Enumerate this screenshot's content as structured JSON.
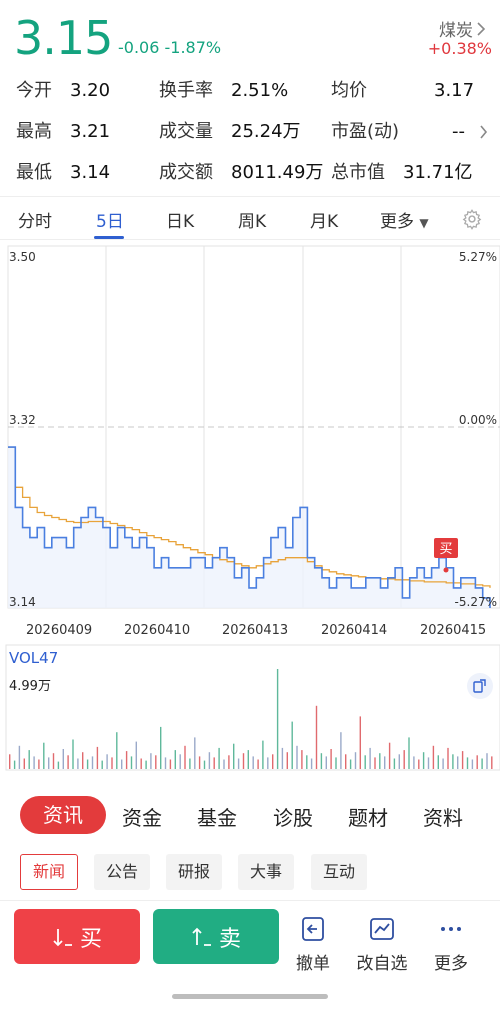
{
  "quote": {
    "price": "3.15",
    "change": "-0.06",
    "change_pct": "-1.87%",
    "sector": "煤炭",
    "sector_change": "+0.38%"
  },
  "stats": {
    "open_label": "今开",
    "open": "3.20",
    "turnover_label": "换手率",
    "turnover": "2.51%",
    "avg_label": "均价",
    "avg": "3.17",
    "high_label": "最高",
    "high": "3.21",
    "volume_label": "成交量",
    "volume": "25.24万",
    "pe_label": "市盈(动)",
    "pe": "--",
    "low_label": "最低",
    "low": "3.14",
    "amount_label": "成交额",
    "amount": "8011.49万",
    "mktcap_label": "总市值",
    "mktcap": "31.71亿"
  },
  "tabs": {
    "intraday": "分时",
    "five_day": "5日",
    "daily": "日K",
    "weekly": "周K",
    "monthly": "月K",
    "more": "更多"
  },
  "chart_data": {
    "type": "line",
    "y_axis_left": [
      "3.50",
      "3.32",
      "3.14"
    ],
    "y_axis_right": [
      "5.27%",
      "0.00%",
      "-5.27%"
    ],
    "ylim": [
      3.14,
      3.5
    ],
    "reference_price": 3.32,
    "dates": [
      "20260409",
      "20260410",
      "20260413",
      "20260414",
      "20260415"
    ],
    "series": [
      {
        "values": [
          3.3,
          3.24,
          3.22,
          3.21,
          3.22,
          3.2,
          3.21,
          3.21,
          3.2,
          3.22,
          3.23,
          3.24,
          3.23,
          3.22,
          3.2,
          3.22,
          3.21,
          3.2,
          3.21,
          3.2,
          3.18,
          3.19,
          3.18,
          3.18,
          3.18,
          3.19,
          3.19,
          3.18,
          3.19,
          3.2,
          3.19,
          3.17,
          3.18,
          3.16,
          3.17,
          3.19,
          3.21,
          3.22,
          3.2,
          3.23,
          3.24,
          3.19,
          3.18,
          3.17,
          3.16,
          3.17,
          3.17,
          3.16,
          3.16,
          3.17,
          3.17,
          3.16,
          3.17,
          3.18,
          3.15,
          3.17,
          3.18,
          3.17,
          3.18,
          3.19,
          3.18,
          3.16,
          3.17,
          3.17,
          3.16,
          3.15,
          3.14
        ]
      },
      {
        "values": [
          3.3,
          3.26,
          3.25,
          3.24,
          3.235,
          3.232,
          3.23,
          3.228,
          3.226,
          3.225,
          3.225,
          3.226,
          3.226,
          3.226,
          3.224,
          3.222,
          3.22,
          3.218,
          3.215,
          3.212,
          3.21,
          3.208,
          3.206,
          3.203,
          3.2,
          3.198,
          3.195,
          3.193,
          3.19,
          3.188,
          3.186,
          3.184,
          3.182,
          3.18,
          3.182,
          3.184,
          3.186,
          3.188,
          3.19,
          3.19,
          3.19,
          3.186,
          3.182,
          3.178,
          3.176,
          3.174,
          3.173,
          3.172,
          3.171,
          3.17,
          3.17,
          3.169,
          3.169,
          3.168,
          3.168,
          3.167,
          3.167,
          3.166,
          3.166,
          3.166,
          3.165,
          3.165,
          3.164,
          3.164,
          3.163,
          3.162,
          3.16
        ]
      }
    ],
    "annotation": "买"
  },
  "volume": {
    "title": "VOL47",
    "max_label": "4.99万",
    "values": [
      14,
      8,
      22,
      10,
      18,
      12,
      9,
      25,
      11,
      15,
      7,
      19,
      13,
      28,
      10,
      16,
      9,
      12,
      21,
      8,
      14,
      11,
      35,
      9,
      17,
      12,
      26,
      10,
      8,
      15,
      13,
      40,
      11,
      9,
      18,
      14,
      22,
      10,
      30,
      12,
      8,
      16,
      11,
      20,
      9,
      13,
      24,
      10,
      15,
      18,
      12,
      9,
      27,
      11,
      14,
      95,
      20,
      16,
      45,
      22,
      18,
      13,
      10,
      60,
      15,
      12,
      19,
      11,
      35,
      14,
      9,
      16,
      50,
      13,
      20,
      11,
      15,
      12,
      25,
      10,
      14,
      18,
      30,
      12,
      9,
      16,
      11,
      22,
      13,
      10,
      20,
      14,
      12,
      17,
      11,
      9,
      13,
      10,
      15,
      12
    ]
  },
  "news_tabs": [
    "资讯",
    "资金",
    "基金",
    "诊股",
    "题材",
    "资料"
  ],
  "sub_tabs": [
    "新闻",
    "公告",
    "研报",
    "大事",
    "互动"
  ],
  "bottom": {
    "buy": "买",
    "sell": "卖",
    "cancel": "撤单",
    "edit_watch": "改自选",
    "more": "更多"
  }
}
